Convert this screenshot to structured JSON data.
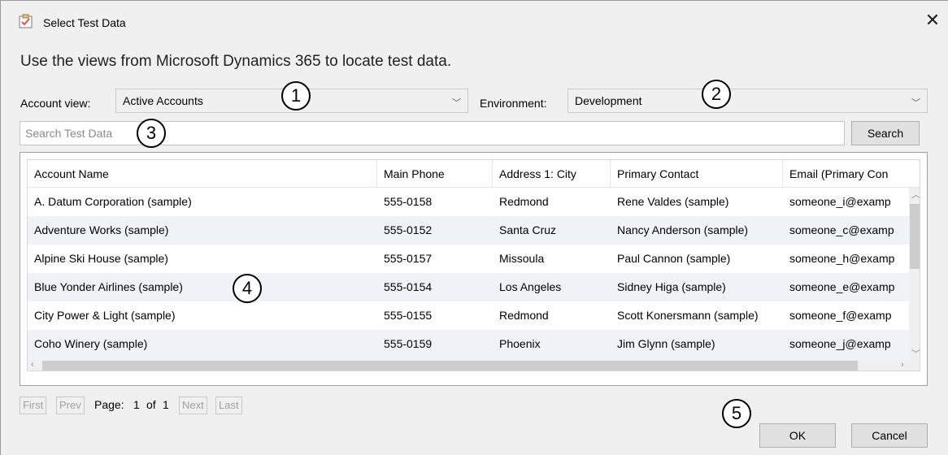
{
  "window": {
    "title": "Select Test Data"
  },
  "heading": "Use the views from Microsoft Dynamics 365 to locate test data.",
  "filters": {
    "account_view_label": "Account view:",
    "account_view_value": "Active Accounts",
    "environment_label": "Environment:",
    "environment_value": "Development"
  },
  "search": {
    "placeholder": "Search Test Data",
    "button_label": "Search"
  },
  "table": {
    "columns": [
      "Account Name",
      "Main Phone",
      "Address 1: City",
      "Primary Contact",
      "Email (Primary Con"
    ],
    "rows": [
      [
        "A. Datum Corporation (sample)",
        "555-0158",
        "Redmond",
        "Rene Valdes (sample)",
        "someone_i@examp"
      ],
      [
        "Adventure Works (sample)",
        "555-0152",
        "Santa Cruz",
        "Nancy Anderson (sample)",
        "someone_c@examp"
      ],
      [
        "Alpine Ski House (sample)",
        "555-0157",
        "Missoula",
        "Paul Cannon (sample)",
        "someone_h@examp"
      ],
      [
        "Blue Yonder Airlines (sample)",
        "555-0154",
        "Los Angeles",
        "Sidney Higa (sample)",
        "someone_e@examp"
      ],
      [
        "City Power & Light (sample)",
        "555-0155",
        "Redmond",
        "Scott Konersmann (sample)",
        "someone_f@examp"
      ],
      [
        "Coho Winery (sample)",
        "555-0159",
        "Phoenix",
        "Jim Glynn (sample)",
        "someone_j@examp"
      ]
    ]
  },
  "pager": {
    "first": "First",
    "prev": "Prev",
    "page_label": "Page:",
    "current": "1",
    "of": "of",
    "total": "1",
    "next": "Next",
    "last": "Last"
  },
  "footer": {
    "ok_label": "OK",
    "cancel_label": "Cancel"
  },
  "callouts": [
    "1",
    "2",
    "3",
    "4",
    "5"
  ],
  "icons": {
    "app": "test-data-icon",
    "close": "close-icon",
    "dropdown": "chevron-down-icon"
  },
  "colors": {
    "alt_row": "#eff3f8",
    "icon_accent": "#d9534f"
  }
}
